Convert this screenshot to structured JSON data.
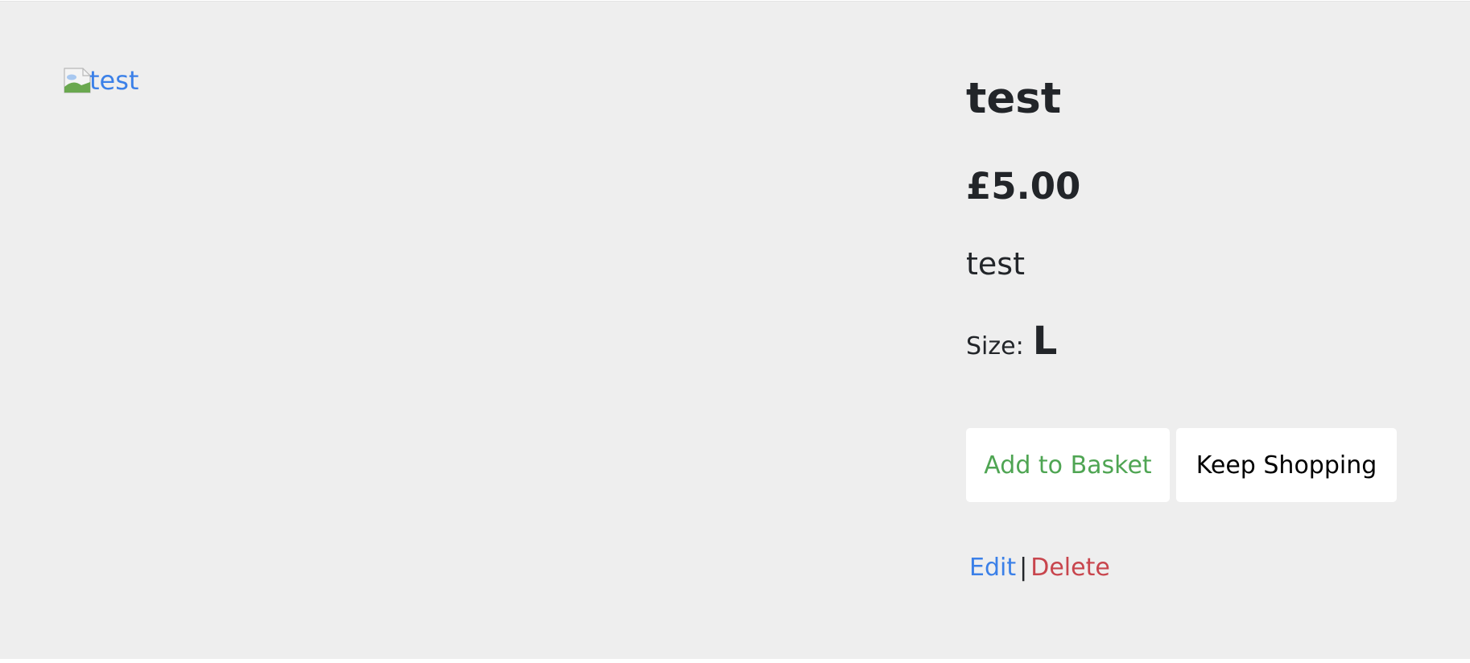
{
  "product": {
    "image_alt": "test",
    "title": "test",
    "price": "£5.00",
    "description": "test",
    "size_label": "Size:",
    "size_value": "L"
  },
  "buttons": {
    "add_to_basket": "Add to Basket",
    "keep_shopping": "Keep Shopping"
  },
  "admin_links": {
    "edit": "Edit",
    "separator": "|",
    "delete": "Delete"
  },
  "icons": {
    "broken_image": "broken-image-icon"
  },
  "colors": {
    "background": "#eeeeee",
    "text": "#222529",
    "link_blue": "#3b80e8",
    "add_green": "#4fa553",
    "delete_red": "#c8454d",
    "button_bg": "#ffffff"
  }
}
